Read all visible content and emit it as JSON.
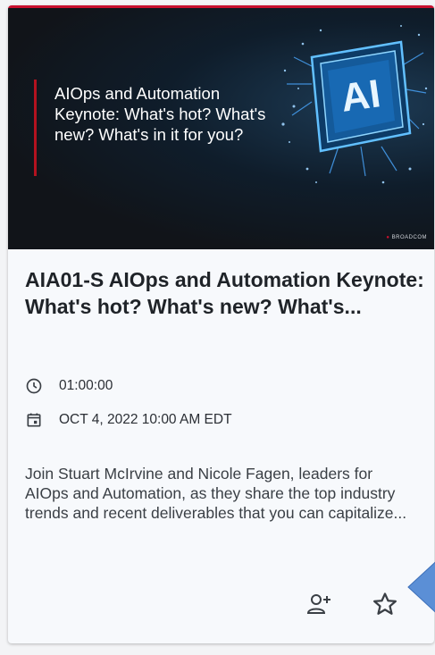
{
  "card": {
    "thumbnail": {
      "title": "AIOps and Automation Keynote: What's hot? What's new? What's in it for you?",
      "chip_label": "AI",
      "logo": "BROADCOM"
    },
    "title": "AIA01-S AIOps and Automation Keynote: What's hot? What's new? What's...",
    "duration": "01:00:00",
    "datetime": "OCT 4, 2022 10:00 AM EDT",
    "description": "Join Stuart McIrvine and Nicole Fagen, leaders for AIOps and Automation, as they share the top industry trends and recent deliverables that you can capitalize...",
    "actions": {
      "add_person_icon": "person-add-icon",
      "favorite_icon": "star-outline-icon"
    }
  },
  "colors": {
    "brand_red": "#c8102e",
    "pointer_blue": "#5b8fd6"
  }
}
